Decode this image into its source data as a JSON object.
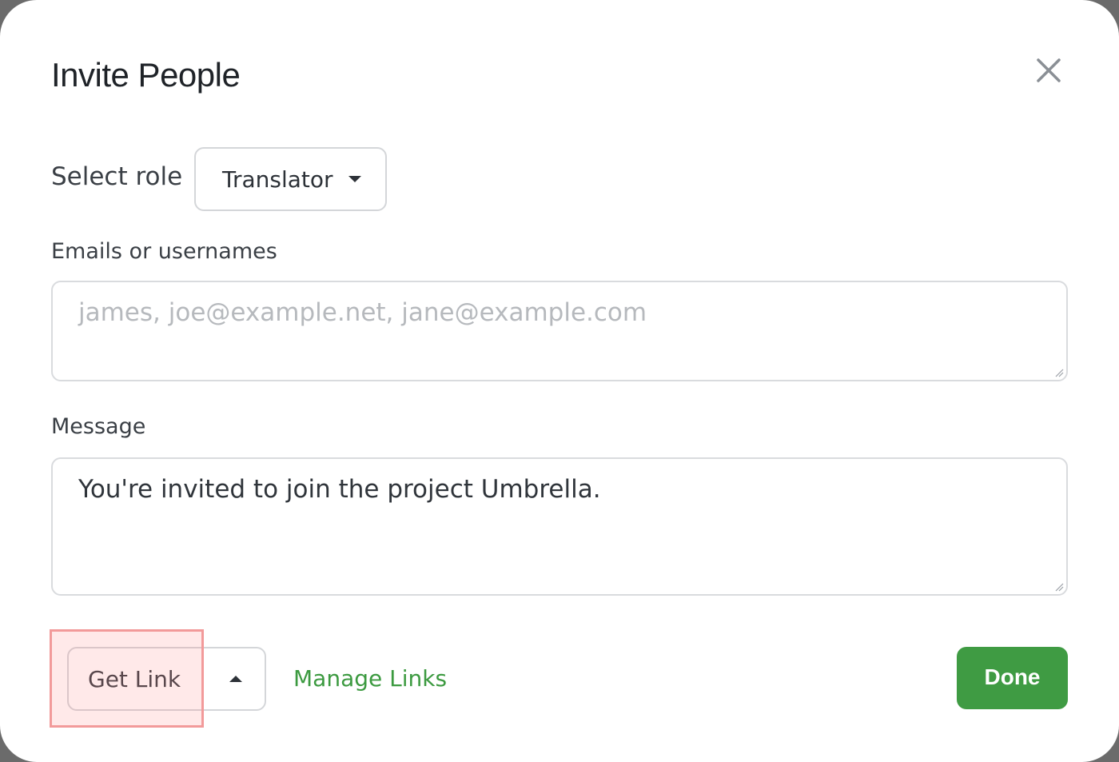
{
  "dialog": {
    "title": "Invite People",
    "close_icon": "close-icon"
  },
  "role": {
    "label": "Select role",
    "selected": "Translator",
    "caret_icon": "caret-down-icon"
  },
  "emails": {
    "label": "Emails or usernames",
    "placeholder": "james, joe@example.net, jane@example.com",
    "value": ""
  },
  "message": {
    "label": "Message",
    "value": "You're invited to join the project Umbrella."
  },
  "footer": {
    "get_link_label": "Get Link",
    "get_link_caret_icon": "caret-up-icon",
    "manage_links_label": "Manage Links",
    "done_label": "Done"
  },
  "colors": {
    "accent_green": "#3f9b43",
    "link_green": "#3c9a40",
    "highlight_border": "#f29a9a"
  }
}
